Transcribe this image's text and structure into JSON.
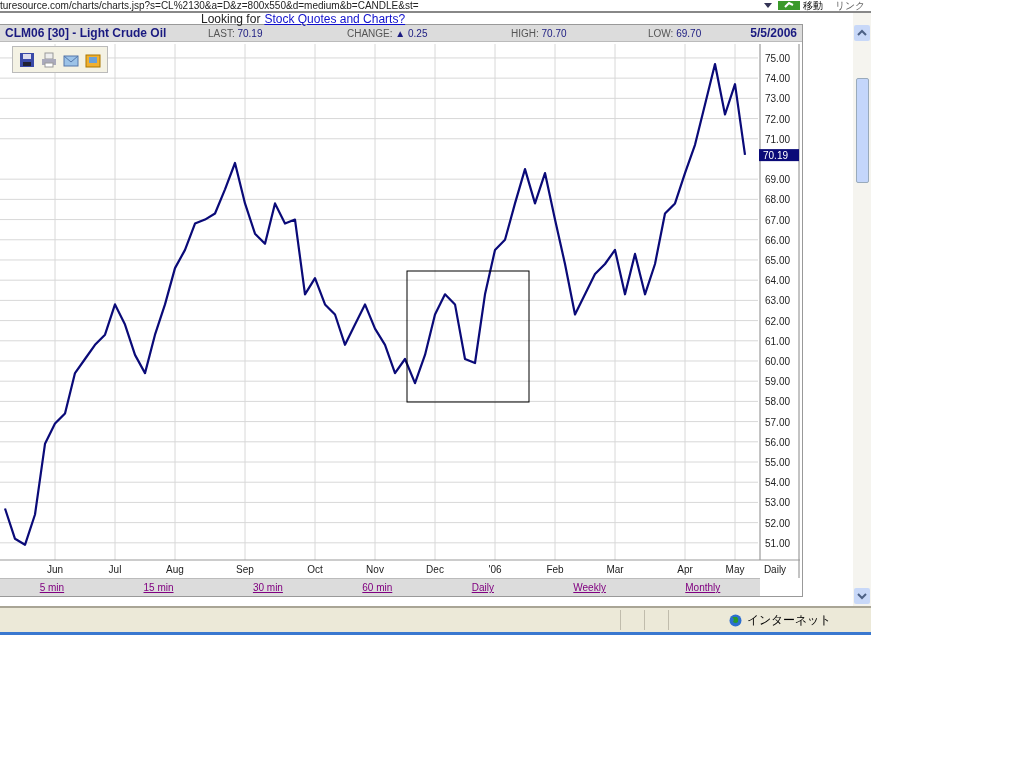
{
  "browser": {
    "address": "turesource.com/charts/charts.jsp?s=CL%2130&a=D&z=800x550&d=medium&b=CANDLE&st=",
    "go_label": "移動",
    "links_label": "リンク"
  },
  "promo": {
    "text": "Looking for",
    "link": "Stock Quotes and Charts?"
  },
  "quote": {
    "symbol": "CLM06 [30] - Light Crude Oil",
    "last_label": "LAST:",
    "last": "70.19",
    "change_label": "CHANGE:",
    "change_arrow": "▲",
    "change": "0.25",
    "high_label": "HIGH:",
    "high": "70.70",
    "low_label": "LOW:",
    "low": "69.70",
    "date": "5/5/2006"
  },
  "chart": {
    "price_tag": "70.19",
    "period_label": "Daily",
    "chart_data": {
      "type": "line",
      "grid": true,
      "ylim": [
        50.15,
        75.69
      ],
      "categories": [
        null,
        null,
        null,
        null,
        null,
        "Jun",
        null,
        null,
        null,
        null,
        null,
        "Jul",
        null,
        null,
        null,
        null,
        null,
        "Aug",
        null,
        null,
        null,
        null,
        null,
        null,
        "Sep",
        null,
        null,
        null,
        null,
        null,
        null,
        "Oct",
        null,
        null,
        null,
        null,
        null,
        "Nov",
        null,
        null,
        null,
        null,
        null,
        "Dec",
        null,
        null,
        null,
        null,
        null,
        "'06",
        null,
        null,
        null,
        null,
        null,
        "Feb",
        null,
        null,
        null,
        null,
        null,
        "Mar",
        null,
        null,
        null,
        null,
        null,
        null,
        "Apr",
        null,
        null,
        null,
        null,
        "May",
        null
      ],
      "series": [
        {
          "color": "#0a0a78",
          "values": [
            52.7,
            51.2,
            50.9,
            52.4,
            55.9,
            56.9,
            57.4,
            59.4,
            60.1,
            60.8,
            61.3,
            62.8,
            61.8,
            60.3,
            59.4,
            61.3,
            62.8,
            64.6,
            65.5,
            66.8,
            67.0,
            67.3,
            68.5,
            69.8,
            67.8,
            66.3,
            65.8,
            67.8,
            66.8,
            67.0,
            63.3,
            64.1,
            62.8,
            62.3,
            60.8,
            61.8,
            62.8,
            61.6,
            60.8,
            59.4,
            60.1,
            58.9,
            60.3,
            62.3,
            63.3,
            62.8,
            60.1,
            59.9,
            63.3,
            65.5,
            66.0,
            67.8,
            69.5,
            67.8,
            69.3,
            67.0,
            64.8,
            62.3,
            63.3,
            64.3,
            64.8,
            65.5,
            63.3,
            65.3,
            63.3,
            64.8,
            67.3,
            67.8,
            69.3,
            70.7,
            72.7,
            74.7,
            72.2,
            73.7,
            70.2
          ]
        }
      ],
      "yticks": [
        {
          "value": 51,
          "label": "51.00"
        },
        {
          "value": 52,
          "label": "52.00"
        },
        {
          "value": 53,
          "label": "53.00"
        },
        {
          "value": 54,
          "label": "54.00"
        },
        {
          "value": 55,
          "label": "55.00"
        },
        {
          "value": 56,
          "label": "56.00"
        },
        {
          "value": 57,
          "label": "57.00"
        },
        {
          "value": 58,
          "label": "58.00"
        },
        {
          "value": 59,
          "label": "59.00"
        },
        {
          "value": 60,
          "label": "60.00"
        },
        {
          "value": 61,
          "label": "61.00"
        },
        {
          "value": 62,
          "label": "62.00"
        },
        {
          "value": 63,
          "label": "63.00"
        },
        {
          "value": 64,
          "label": "64.00"
        },
        {
          "value": 65,
          "label": "65.00"
        },
        {
          "value": 66,
          "label": "66.00"
        },
        {
          "value": 67,
          "label": "67.00"
        },
        {
          "value": 68,
          "label": "68.00"
        },
        {
          "value": 69,
          "label": "69.00"
        },
        {
          "value": 71,
          "label": "71.00"
        },
        {
          "value": 72,
          "label": "72.00"
        },
        {
          "value": 73,
          "label": "73.00"
        },
        {
          "value": 74,
          "label": "74.00"
        },
        {
          "value": 75,
          "label": "75.00"
        }
      ]
    }
  },
  "intervals": [
    "5 min",
    "15 min",
    "30 min",
    "60 min",
    "Daily",
    "Weekly",
    "Monthly"
  ],
  "status_bar": {
    "zone": "インターネット"
  }
}
